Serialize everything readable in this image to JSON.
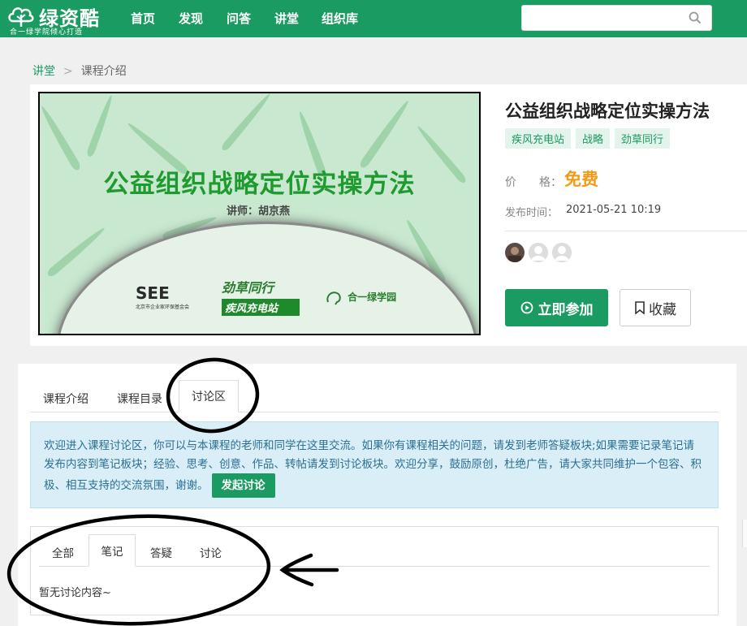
{
  "header": {
    "brand": "绿资酷",
    "slogan": "合一绿学院倾心打造",
    "nav": [
      "首页",
      "发现",
      "问答",
      "讲堂",
      "组织库"
    ],
    "search_placeholder": ""
  },
  "breadcrumb": {
    "root": "讲堂",
    "separator": ">",
    "current": "课程介绍"
  },
  "course": {
    "cover": {
      "title": "公益组织战略定位实操方法",
      "lecturer": "讲师：胡京燕",
      "logo_see": "SEE",
      "logo_see_sub": "北京市企业家环保基金会",
      "logo_jc_top": "劲草同行",
      "logo_jc_bottom": "疾风充电站",
      "logo_he": "合一绿学园"
    },
    "title": "公益组织战略定位实操方法",
    "tags": [
      "疾风充电站",
      "战略",
      "劲草同行"
    ],
    "price_label": "价　　格：",
    "price_value": "免费",
    "date_label": "发布时间：",
    "date_value": "2021-05-21 10:19",
    "join_label": "立即参加",
    "fav_label": "收藏"
  },
  "tabs": {
    "intro": "课程介绍",
    "catalog": "课程目录",
    "discussion": "讨论区"
  },
  "notice": {
    "text": "欢迎进入课程讨论区，你可以与本课程的老师和同学在这里交流。如果你有课程相关的问题，请发到老师答疑板块;如果需要记录笔记请发布内容到笔记板块；经验、思考、创意、作品、转帖请发到讨论板块。欢迎分享，鼓励原创，杜绝广告，请大家共同维护一个包容、积极、相互支持的交流氛围，谢谢。",
    "button": "发起讨论"
  },
  "subtabs": {
    "all": "全部",
    "notes": "笔记",
    "qa": "答疑",
    "discuss": "讨论"
  },
  "empty_text": "暂无讨论内容~",
  "colors": {
    "brand": "#1a9b62",
    "price": "#f39a18",
    "notice_bg": "#d9eef7"
  }
}
